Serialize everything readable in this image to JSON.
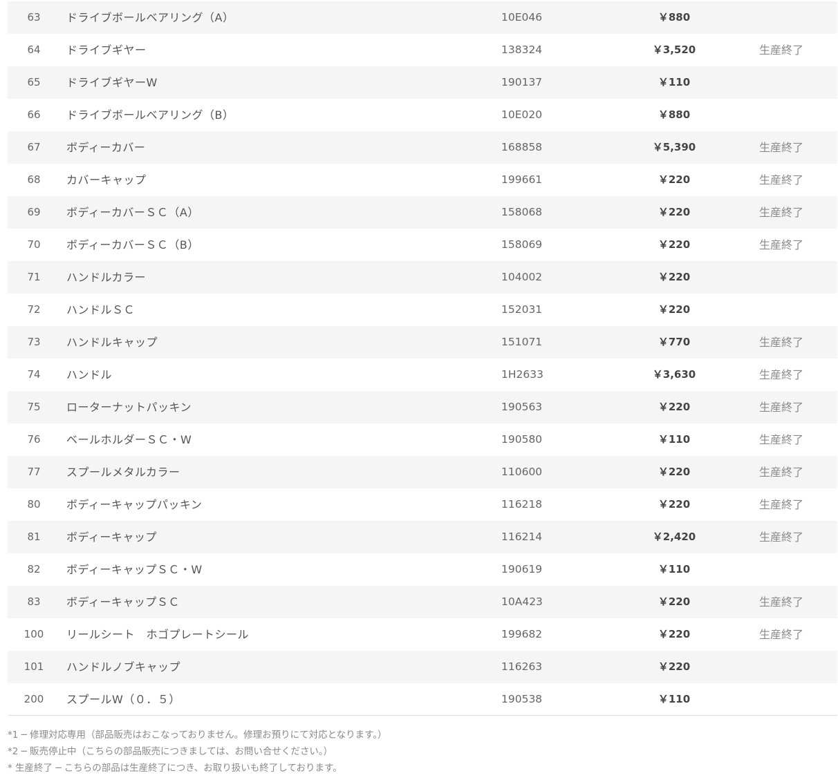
{
  "parts": [
    {
      "no": "63",
      "name": "ドライブボールベアリング（A）",
      "code": "10E046",
      "price": "￥880",
      "status": ""
    },
    {
      "no": "64",
      "name": "ドライブギヤー",
      "code": "138324",
      "price": "￥3,520",
      "status": "生産終了"
    },
    {
      "no": "65",
      "name": "ドライブギヤーW",
      "code": "190137",
      "price": "￥110",
      "status": ""
    },
    {
      "no": "66",
      "name": "ドライブボールベアリング（B）",
      "code": "10E020",
      "price": "￥880",
      "status": ""
    },
    {
      "no": "67",
      "name": "ボディーカバー",
      "code": "168858",
      "price": "￥5,390",
      "status": "生産終了"
    },
    {
      "no": "68",
      "name": "カバーキャップ",
      "code": "199661",
      "price": "￥220",
      "status": "生産終了"
    },
    {
      "no": "69",
      "name": "ボディーカバーＳＣ（A）",
      "code": "158068",
      "price": "￥220",
      "status": "生産終了"
    },
    {
      "no": "70",
      "name": "ボディーカバーＳＣ（B）",
      "code": "158069",
      "price": "￥220",
      "status": "生産終了"
    },
    {
      "no": "71",
      "name": "ハンドルカラー",
      "code": "104002",
      "price": "￥220",
      "status": ""
    },
    {
      "no": "72",
      "name": "ハンドルＳＣ",
      "code": "152031",
      "price": "￥220",
      "status": ""
    },
    {
      "no": "73",
      "name": "ハンドルキャップ",
      "code": "151071",
      "price": "￥770",
      "status": "生産終了"
    },
    {
      "no": "74",
      "name": "ハンドル",
      "code": "1H2633",
      "price": "￥3,630",
      "status": "生産終了"
    },
    {
      "no": "75",
      "name": "ローターナットパッキン",
      "code": "190563",
      "price": "￥220",
      "status": "生産終了"
    },
    {
      "no": "76",
      "name": "ベールホルダーＳＣ・W",
      "code": "190580",
      "price": "￥110",
      "status": "生産終了"
    },
    {
      "no": "77",
      "name": "スプールメタルカラー",
      "code": "110600",
      "price": "￥220",
      "status": "生産終了"
    },
    {
      "no": "80",
      "name": "ボディーキャップパッキン",
      "code": "116218",
      "price": "￥220",
      "status": "生産終了"
    },
    {
      "no": "81",
      "name": "ボディーキャップ",
      "code": "116214",
      "price": "￥2,420",
      "status": "生産終了"
    },
    {
      "no": "82",
      "name": "ボディーキャップＳＣ・W",
      "code": "190619",
      "price": "￥110",
      "status": ""
    },
    {
      "no": "83",
      "name": "ボディーキャップＳＣ",
      "code": "10A423",
      "price": "￥220",
      "status": "生産終了"
    },
    {
      "no": "100",
      "name": "リールシート　ホゴプレートシール",
      "code": "199682",
      "price": "￥220",
      "status": "生産終了"
    },
    {
      "no": "101",
      "name": "ハンドルノブキャップ",
      "code": "116263",
      "price": "￥220",
      "status": ""
    },
    {
      "no": "200",
      "name": "スプールW（０．５）",
      "code": "190538",
      "price": "￥110",
      "status": ""
    }
  ],
  "notes": [
    "*1 ─ 修理対応専用（部品販売はおこなっておりません。修理お預りにて対応となります。）",
    "*2 ─ 販売停止中（こちらの部品販売につきましては、お問い合せください。）",
    "* 生産終了 ─ こちらの部品は生産終了につき、お取り扱いも終了しております。"
  ]
}
